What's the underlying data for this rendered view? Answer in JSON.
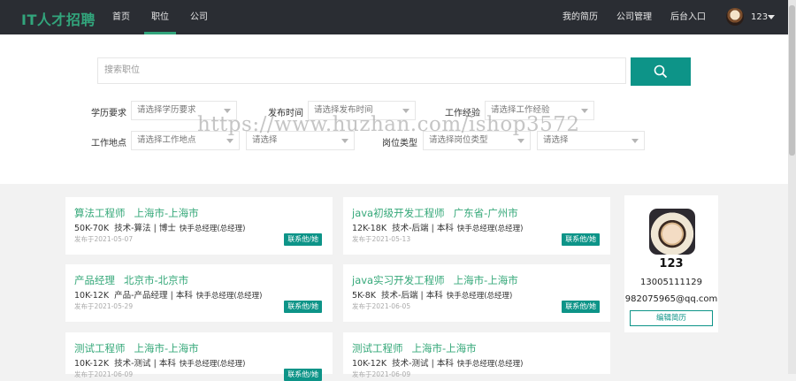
{
  "nav": {
    "logo": "IT人才招聘",
    "items": [
      {
        "label": "首页"
      },
      {
        "label": "职位"
      },
      {
        "label": "公司"
      }
    ],
    "right_items": [
      {
        "label": "我的简历"
      },
      {
        "label": "公司管理"
      },
      {
        "label": "后台入口"
      }
    ],
    "user_name": "123"
  },
  "search": {
    "placeholder": "搜索职位",
    "button_icon": "search-icon"
  },
  "filters": {
    "education": {
      "label": "学历要求",
      "placeholder": "请选择学历要求"
    },
    "publish_time": {
      "label": "发布时间",
      "placeholder": "请选择发布时间"
    },
    "experience": {
      "label": "工作经验",
      "placeholder": "请选择工作经验"
    },
    "location": {
      "label": "工作地点",
      "placeholder": "请选择工作地点",
      "sub_placeholder": "请选择"
    },
    "job_type": {
      "label": "岗位类型",
      "placeholder": "请选择岗位类型",
      "sub_placeholder": "请选择"
    }
  },
  "jobs": [
    {
      "title": "算法工程师",
      "location": "上海市-上海市",
      "salary": "50K-70K",
      "category": "技术-算法",
      "education": "博士",
      "company": "快手总经理(总经理)",
      "date": "发布于2021-05-07",
      "contact": "联系他/她"
    },
    {
      "title": "java初级开发工程师",
      "location": "广东省-广州市",
      "salary": "12K-18K",
      "category": "技术-后端",
      "education": "本科",
      "company": "快手总经理(总经理)",
      "date": "发布于2021-05-13",
      "contact": "联系他/她"
    },
    {
      "title": "产品经理",
      "location": "北京市-北京市",
      "salary": "10K-12K",
      "category": "产品-产品经理",
      "education": "本科",
      "company": "快手总经理(总经理)",
      "date": "发布于2021-05-29",
      "contact": "联系他/她"
    },
    {
      "title": "java实习开发工程师",
      "location": "上海市-上海市",
      "salary": "5K-8K",
      "category": "技术-后端",
      "education": "本科",
      "company": "快手总经理(总经理)",
      "date": "发布于2021-06-05",
      "contact": "联系他/她"
    },
    {
      "title": "测试工程师",
      "location": "上海市-上海市",
      "salary": "10K-12K",
      "category": "技术-测试",
      "education": "本科",
      "company": "快手总经理(总经理)",
      "date": "发布于2021-06-09",
      "contact": "联系他/她"
    },
    {
      "title": "测试工程师",
      "location": "上海市-上海市",
      "salary": "10K-12K",
      "category": "技术-测试",
      "education": "本科",
      "company": "快手总经理(总经理)",
      "date": "发布于2021-06-09",
      "contact": "联系他/她"
    }
  ],
  "profile": {
    "name": "123",
    "phone": "13005111129",
    "email": "982075965@qq.com",
    "edit_label": "编辑简历"
  },
  "watermark": "https://www.huzhan.com/ishop3572",
  "colors": {
    "accent": "#0d9488",
    "logo": "#32a57c",
    "nav_bg": "#2a2d33"
  }
}
